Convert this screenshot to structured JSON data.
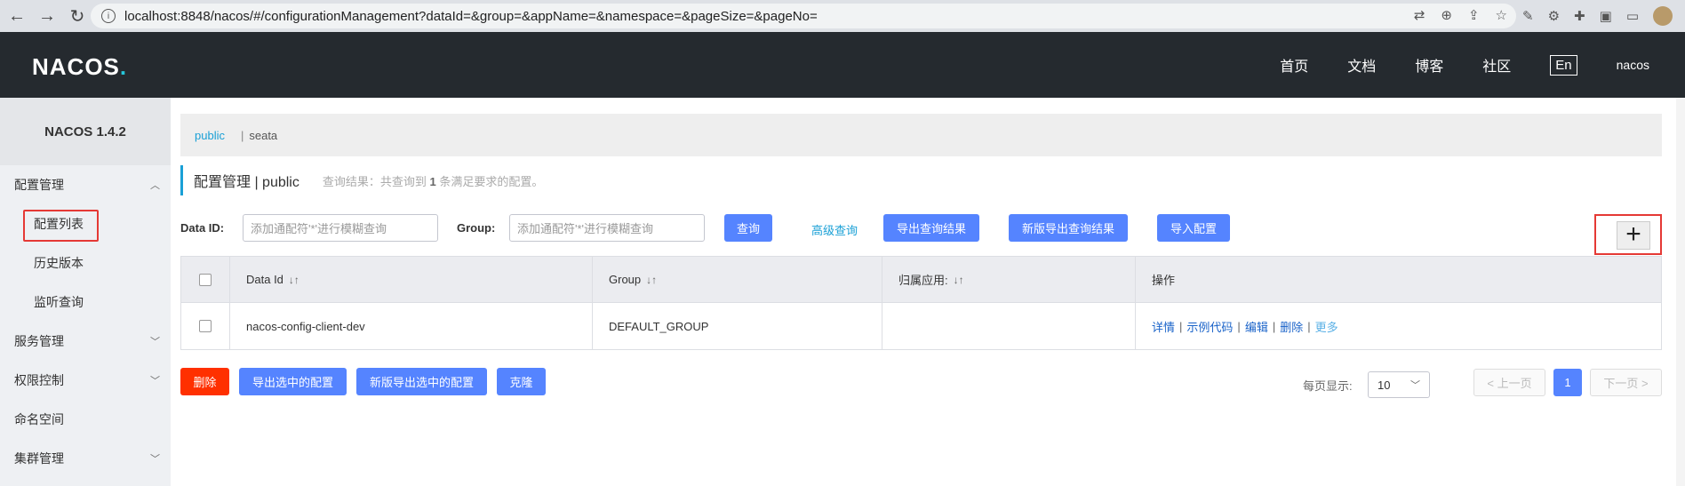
{
  "browser": {
    "url": "localhost:8848/nacos/#/configurationManagement?dataId=&group=&appName=&namespace=&pageSize=&pageNo="
  },
  "header": {
    "logo": "NACOS",
    "logo_dot": ".",
    "nav": [
      "首页",
      "文档",
      "博客",
      "社区"
    ],
    "lang": "En",
    "user": "nacos"
  },
  "sidebar": {
    "version": "NACOS 1.4.2",
    "groups": [
      {
        "label": "配置管理",
        "expanded": true
      },
      {
        "label": "服务管理"
      },
      {
        "label": "权限控制"
      },
      {
        "label": "命名空间"
      },
      {
        "label": "集群管理"
      }
    ],
    "config_items": [
      "配置列表",
      "历史版本",
      "监听查询"
    ]
  },
  "namespace_bar": {
    "active": "public",
    "sep": "|",
    "other": "seata"
  },
  "title": {
    "text": "配置管理 | public",
    "hint_prefix": "查询结果：共查询到",
    "hint_count": "1",
    "hint_suffix": "条满足要求的配置。"
  },
  "filter": {
    "dataid_label": "Data ID:",
    "dataid_placeholder": "添加通配符'*'进行模糊查询",
    "group_label": "Group:",
    "group_placeholder": "添加通配符'*'进行模糊查询",
    "query": "查询",
    "advanced": "高级查询",
    "export": "导出查询结果",
    "new_export": "新版导出查询结果",
    "import": "导入配置",
    "add": "+"
  },
  "table": {
    "headers": [
      "Data Id",
      "Group",
      "归属应用:",
      "操作"
    ],
    "rows": [
      {
        "data_id": "nacos-config-client-dev",
        "group": "DEFAULT_GROUP",
        "app": ""
      }
    ],
    "ops": [
      "详情",
      "示例代码",
      "编辑",
      "删除",
      "更多"
    ],
    "sort_icon": "↓↑"
  },
  "bottom": {
    "delete": "删除",
    "export_selected": "导出选中的配置",
    "new_export_selected": "新版导出选中的配置",
    "clone": "克隆",
    "page_size_label": "每页显示:",
    "page_size": "10",
    "prev": "< 上一页",
    "current_page": "1",
    "next": "下一页 >"
  },
  "colors": {
    "accent": "#5584ff",
    "danger": "#ff3000",
    "header_bg": "#252a2f",
    "link": "#1aa0d6"
  }
}
